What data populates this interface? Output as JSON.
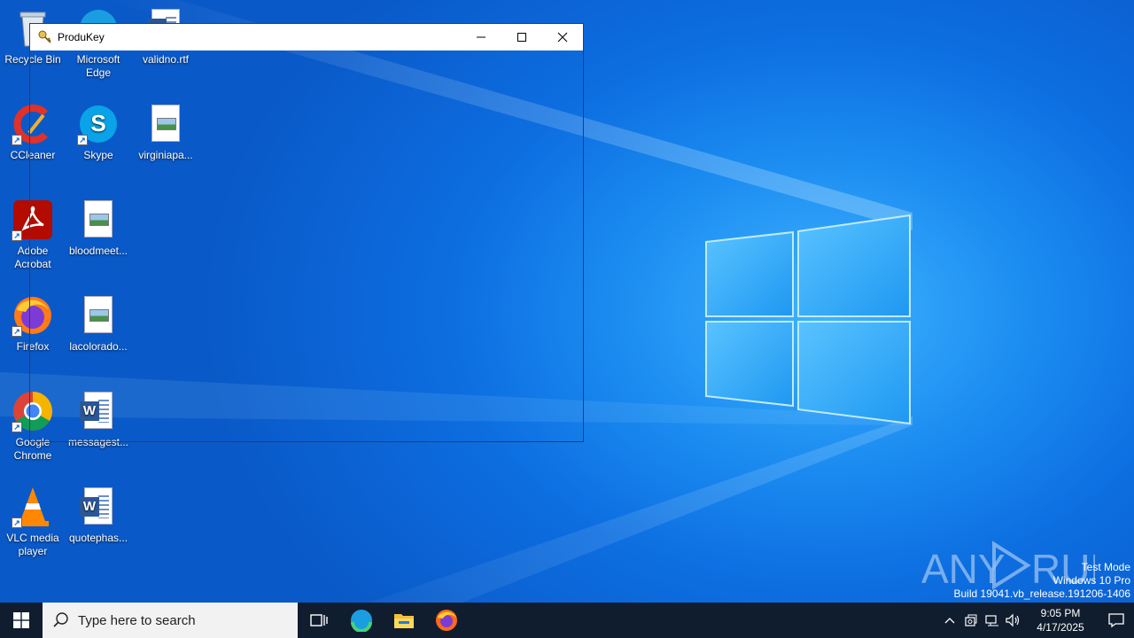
{
  "desktop": {
    "icons": [
      {
        "label": "Recycle Bin"
      },
      {
        "label": "Microsoft Edge"
      },
      {
        "label": "validno.rtf"
      },
      {
        "label": "CCleaner"
      },
      {
        "label": "Skype"
      },
      {
        "label": "virginiapa..."
      },
      {
        "label": "Adobe Acrobat"
      },
      {
        "label": "bloodmeet..."
      },
      {
        "label": "Firefox"
      },
      {
        "label": "lacolorado..."
      },
      {
        "label": "Google Chrome"
      },
      {
        "label": "messagest..."
      },
      {
        "label": "VLC media player"
      },
      {
        "label": "quotephas..."
      }
    ]
  },
  "window": {
    "title": "ProduKey",
    "icon": "produkey-key-icon"
  },
  "watermark": {
    "brand": "ANY RUN",
    "line1": "Test Mode",
    "line2": "Windows 10 Pro",
    "line3": "Build 19041.vb_release.191206-1406"
  },
  "taskbar": {
    "search_placeholder": "Type here to search",
    "apps": [
      "task-view-icon",
      "edge-icon",
      "file-explorer-icon",
      "firefox-icon"
    ],
    "time": "9:05 PM",
    "date": "4/17/2025"
  },
  "colors": {
    "taskbar": "#101d2e",
    "wallpaper_accent": "#1a8af0"
  }
}
